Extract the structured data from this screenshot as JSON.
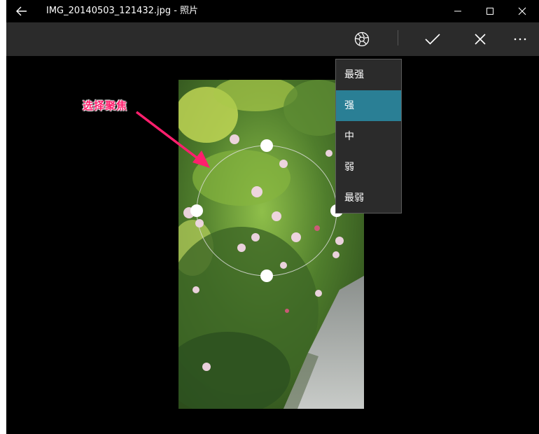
{
  "window": {
    "title": "IMG_20140503_121432.jpg - 照片"
  },
  "titlebar_icons": {
    "back": "back-arrow-icon",
    "minimize": "minimize-icon",
    "maximize": "maximize-icon",
    "close": "close-icon"
  },
  "toolbar": {
    "icons": [
      "vignette-aperture-icon",
      "checkmark-icon",
      "cancel-x-icon",
      "more-ellipsis-icon"
    ],
    "more_label": "···"
  },
  "focus_menu": {
    "items": [
      {
        "label": "最强",
        "selected": false
      },
      {
        "label": "强",
        "selected": true
      },
      {
        "label": "中",
        "selected": false
      },
      {
        "label": "弱",
        "selected": false
      },
      {
        "label": "最弱",
        "selected": false
      }
    ]
  },
  "annotation": {
    "text": "选择聚焦",
    "color": "#ff1f6d"
  },
  "colors": {
    "window_bg": "#000000",
    "toolbar_bg": "#2b2b2b",
    "menu_bg": "#2b2b2b",
    "menu_selected": "#2a7f95"
  }
}
